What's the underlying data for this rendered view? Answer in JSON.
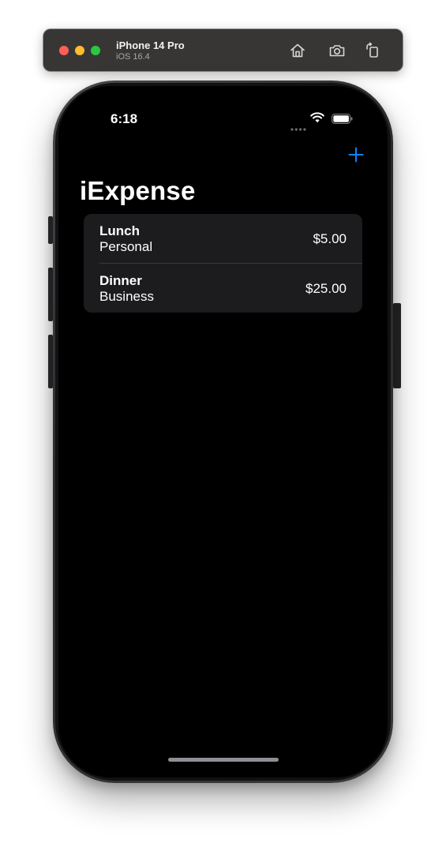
{
  "simulator": {
    "device_name": "iPhone 14 Pro",
    "os_version": "iOS 16.4",
    "buttons": [
      {
        "name": "home",
        "icon": "home-icon"
      },
      {
        "name": "screenshot",
        "icon": "camera-icon"
      },
      {
        "name": "rotate",
        "icon": "rotate-icon"
      }
    ],
    "traffic_lights": {
      "close": "#fe5f57",
      "minimize": "#febc2e",
      "zoom": "#28c840"
    }
  },
  "status_bar": {
    "time": "6:18",
    "icons": [
      "signal-dots-icon",
      "wifi-icon",
      "battery-icon"
    ]
  },
  "nav": {
    "title": "iExpense",
    "add_icon": "plus-icon",
    "accent": "#0a84ff"
  },
  "expenses": [
    {
      "name": "Lunch",
      "type": "Personal",
      "amount": "$5.00"
    },
    {
      "name": "Dinner",
      "type": "Business",
      "amount": "$25.00"
    }
  ]
}
